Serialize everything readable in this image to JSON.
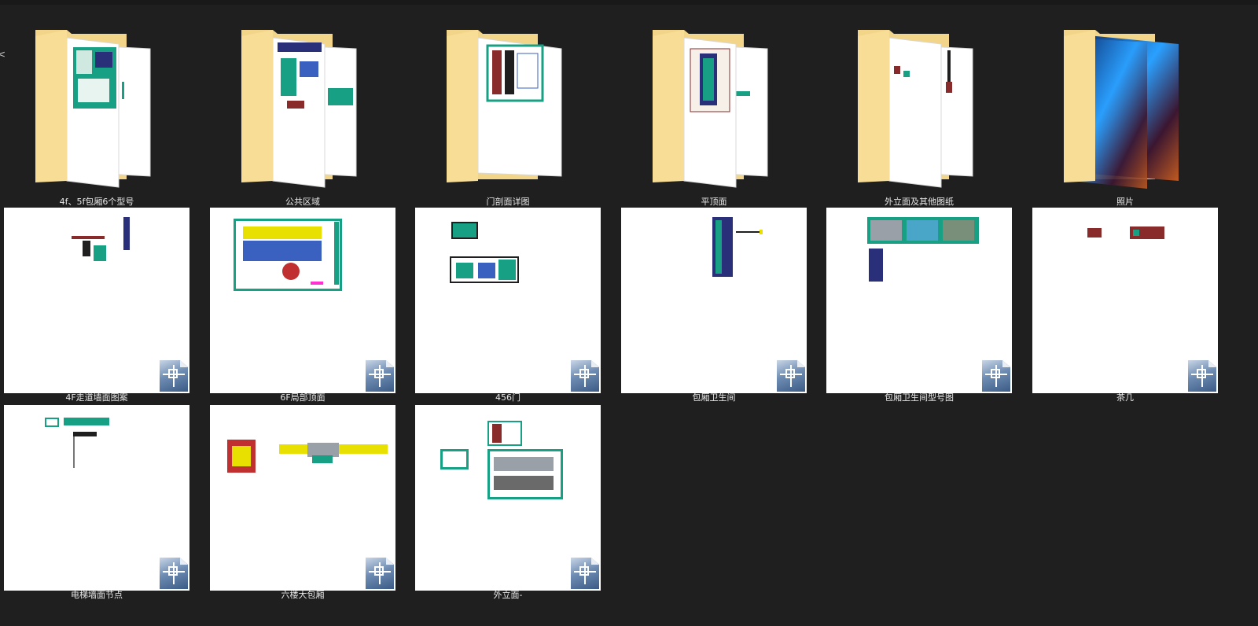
{
  "explorer": {
    "folders": [
      {
        "name": "4f、5f包厢6个型号",
        "icon": "folder-icon"
      },
      {
        "name": "公共区域",
        "icon": "folder-icon"
      },
      {
        "name": "门剖面详图",
        "icon": "folder-icon"
      },
      {
        "name": "平顶面",
        "icon": "folder-icon"
      },
      {
        "name": "外立面及其他图纸",
        "icon": "folder-icon"
      },
      {
        "name": "照片",
        "icon": "folder-icon"
      }
    ],
    "files": [
      {
        "name": "4F走道墙面图案",
        "icon": "dwg-file-icon"
      },
      {
        "name": "6F局部顶面",
        "icon": "dwg-file-icon"
      },
      {
        "name": "456门",
        "icon": "dwg-file-icon"
      },
      {
        "name": "包厢卫生间",
        "icon": "dwg-file-icon"
      },
      {
        "name": "包厢卫生间型号图",
        "icon": "dwg-file-icon"
      },
      {
        "name": "茶几",
        "icon": "dwg-file-icon"
      },
      {
        "name": "电梯墙面节点",
        "icon": "dwg-file-icon"
      },
      {
        "name": "六楼大包厢",
        "icon": "dwg-file-icon"
      },
      {
        "name": "外立面-",
        "icon": "dwg-file-icon"
      }
    ]
  },
  "colors": {
    "background": "#1f1f1f",
    "label": "#e8e8e8",
    "folder_back": "#f3d58a",
    "folder_front": "#f7dd96",
    "cad_teal": "#17a083",
    "cad_navy": "#2a2f7a"
  }
}
